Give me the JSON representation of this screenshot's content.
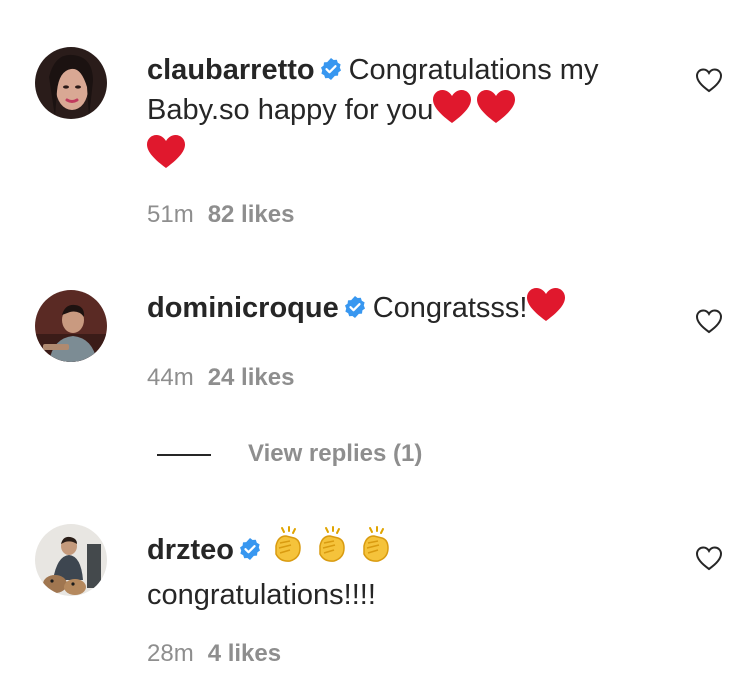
{
  "comments": [
    {
      "username": "claubarretto",
      "verified": true,
      "text": "Congratulations my Baby.so happy for you",
      "emoji": [
        "red-heart",
        "red-heart",
        "red-heart"
      ],
      "time": "51m",
      "likes": "82 likes"
    },
    {
      "username": "dominicroque",
      "verified": true,
      "text": "Congratsss!",
      "emoji": [
        "red-heart"
      ],
      "time": "44m",
      "likes": "24 likes"
    },
    {
      "username": "drzteo",
      "verified": true,
      "text": "congratulations!!!!",
      "emoji": [
        "clapping-hands",
        "clapping-hands",
        "clapping-hands"
      ],
      "time": "28m",
      "likes": "4 likes"
    }
  ],
  "view_replies": "View replies (1)",
  "colors": {
    "text": "#262626",
    "meta": "#8e8e8e",
    "verified": "#3897f0",
    "heart": "#e0182d"
  }
}
